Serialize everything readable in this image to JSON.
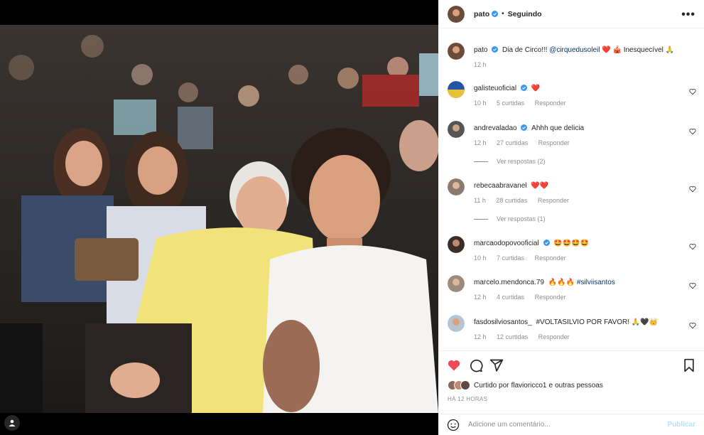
{
  "header": {
    "username": "pato",
    "separator": "•",
    "follow_status": "Seguindo",
    "more_icon": "more-options-icon"
  },
  "caption": {
    "username": "pato",
    "text": "Dia de Circo!!! @cirquedusoleil ❤️ 🎪 Inesquecível 🙏",
    "text_plain": "Dia de Circo!!! ",
    "mention": "@cirquedusoleil",
    "text_after": " ❤️ 🎪 Inesquecível 🙏",
    "time": "12 h"
  },
  "comments": [
    {
      "username": "galisteuoficial",
      "verified": true,
      "text": "❤️",
      "time": "10 h",
      "likes": "5 curtidas",
      "reply": "Responder"
    },
    {
      "username": "andrevaladao",
      "verified": true,
      "text": "Ahhh que delicia",
      "time": "12 h",
      "likes": "27 curtidas",
      "reply": "Responder",
      "view_replies": "Ver respostas (2)"
    },
    {
      "username": "rebecaabravanel",
      "verified": false,
      "text": "❤️❤️",
      "time": "11 h",
      "likes": "28 curtidas",
      "reply": "Responder",
      "view_replies": "Ver respostas (1)"
    },
    {
      "username": "marcaodopovooficial",
      "verified": true,
      "text": "🤩🤩🤩🤩",
      "time": "10 h",
      "likes": "7 curtidas",
      "reply": "Responder"
    },
    {
      "username": "marcelo.mendonca.79",
      "verified": false,
      "text": "🔥🔥🔥",
      "hashtag": "#silviisantos",
      "time": "12 h",
      "likes": "4 curtidas",
      "reply": "Responder"
    },
    {
      "username": "fasdosilviosantos_",
      "verified": false,
      "hashtag": "#VOLTASILVIO",
      "text": "POR FAVOR! 🙏🖤👑",
      "time": "12 h",
      "likes": "12 curtidas",
      "reply": "Responder"
    }
  ],
  "actions": {
    "like_icon": "heart-filled-icon",
    "comment_icon": "comment-icon",
    "share_icon": "share-icon",
    "save_icon": "bookmark-icon"
  },
  "likes": {
    "prefix": "Curtido por",
    "user": "flavioricco1",
    "middle": "e",
    "suffix": "outras pessoas"
  },
  "timestamp": "HÁ 12 HORAS",
  "add_comment": {
    "emoji_icon": "emoji-icon",
    "placeholder": "Adicione um comentário...",
    "publish": "Publicar"
  },
  "colors": {
    "verified": "#3897f0",
    "like_red": "#ed4956",
    "link": "#00376b",
    "publish_disabled": "#b2dffc"
  }
}
